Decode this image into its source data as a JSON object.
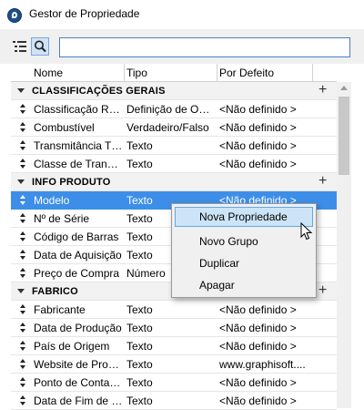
{
  "window": {
    "title": "Gestor de Propriedade"
  },
  "toolbar": {
    "list_icon": "list-view-icon",
    "search_icon": "search-icon",
    "search_value": ""
  },
  "columns": [
    "Nome",
    "Tipo",
    "Por Defeito"
  ],
  "groups": [
    {
      "label": "CLASSIFICAÇÕES GERAIS",
      "rows": [
        {
          "name": "Classificação Resi...",
          "type": "Definição de Opç...",
          "default": "<Não definido >"
        },
        {
          "name": "Combustível",
          "type": "Verdadeiro/Falso",
          "default": "<Não definido >"
        },
        {
          "name": "Transmitância Tér...",
          "type": "Texto",
          "default": "<Não definido >"
        },
        {
          "name": "Classe de Transmi...",
          "type": "Texto",
          "default": "<Não definido >"
        }
      ]
    },
    {
      "label": "INFO PRODUTO",
      "rows": [
        {
          "name": "Modelo",
          "type": "Texto",
          "default": "<Não definido >",
          "selected": true
        },
        {
          "name": "Nº de Série",
          "type": "Texto",
          "default": ""
        },
        {
          "name": "Código de Barras",
          "type": "Texto",
          "default": ""
        },
        {
          "name": "Data de Aquisição",
          "type": "Texto",
          "default": ""
        },
        {
          "name": "Preço de Compra",
          "type": "Número",
          "default": ""
        }
      ]
    },
    {
      "label": "FABRICO",
      "rows": [
        {
          "name": "Fabricante",
          "type": "Texto",
          "default": "<Não definido >"
        },
        {
          "name": "Data de Produção",
          "type": "Texto",
          "default": "<Não definido >"
        },
        {
          "name": "País de Origem",
          "type": "Texto",
          "default": "<Não definido >"
        },
        {
          "name": "Website de Prod...",
          "type": "Texto",
          "default": "www.graphisoft...."
        },
        {
          "name": "Ponto de Contacto",
          "type": "Texto",
          "default": "<Não definido >"
        },
        {
          "name": "Data de Fim de G...",
          "type": "Texto",
          "default": "<Não definido >"
        }
      ]
    }
  ],
  "context_menu": {
    "items": [
      "Nova Propriedade",
      "Novo Grupo",
      "Duplicar",
      "Apagar"
    ],
    "hovered": "Nova Propriedade"
  },
  "colors": {
    "selection": "#3d8ee8",
    "menu_hover": "#cce4f7",
    "group_bg": "#f2f2f2"
  }
}
